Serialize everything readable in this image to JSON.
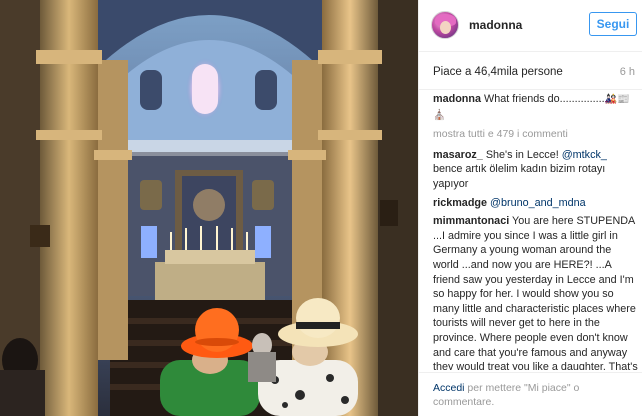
{
  "post": {
    "username": "madonna",
    "follow_label": "Segui",
    "likes_text": "Piace a 46,4mila persone",
    "time": "6 h"
  },
  "caption": {
    "user": "madonna",
    "text": "What friends do...............",
    "emojis": "🎎📰⛪"
  },
  "show_all_comments": "mostra tutti e 479 i commenti",
  "comments": [
    {
      "user": "masaroz_",
      "pre": "She's in Lecce! ",
      "mention": "@mtkck_",
      "post": " bence artık ölelim kadın bizim rotayı yapıyor"
    },
    {
      "user": "rickmadge",
      "pre": "",
      "mention": "@bruno_and_mdna",
      "post": ""
    },
    {
      "user": "mimmantonaci",
      "pre": "You are here STUPENDA ...I admire you since I was a little girl in Germany a young woman around the world ...and now you are HERE?! ...A friend saw you yesterday in Lecce and I'm so happy for her. I would show you so many little and characteristic places where tourists will never get to here in the province. Where people even don't know and care that you're famous and anyway they would treat you like a daughter. That's Salento my home, the place I hardly choose to live, because it's a real life here, but it's not only here",
      "mention": "",
      "post": ""
    }
  ],
  "footer": {
    "login_link": "Accedi",
    "rest": " per mettere \"Mi piace\" o commentare."
  },
  "colors": {
    "accent": "#3897f0",
    "link": "#003569",
    "muted": "#999999",
    "text": "#262626"
  },
  "icons": {
    "avatar": "profile-avatar",
    "post_image": "church-interior-photo"
  }
}
